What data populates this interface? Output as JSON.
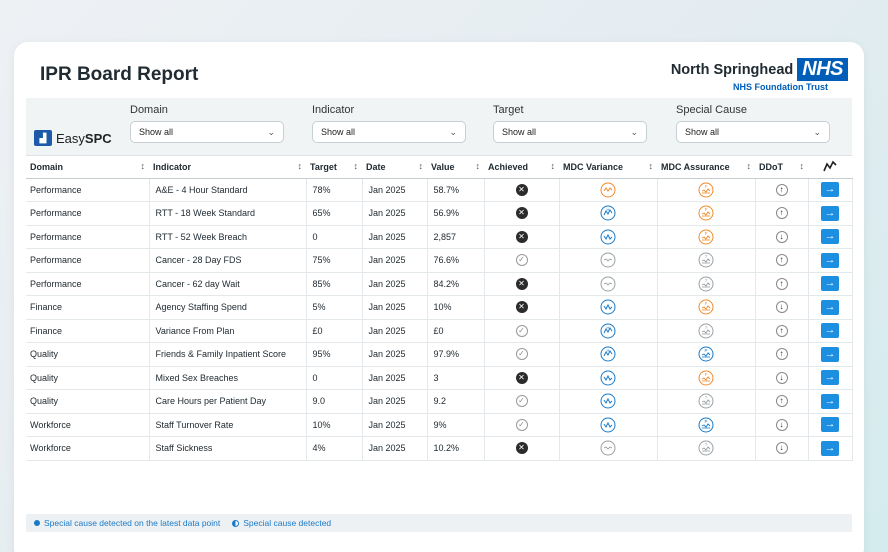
{
  "header": {
    "title": "IPR Board Report"
  },
  "trust": {
    "name": "North Springhead",
    "logo_text": "NHS",
    "subtitle": "NHS Foundation Trust"
  },
  "brand": {
    "light": "Easy",
    "bold": "SPC"
  },
  "filters": [
    {
      "label": "Domain",
      "value": "Show all"
    },
    {
      "label": "Indicator",
      "value": "Show all"
    },
    {
      "label": "Target",
      "value": "Show all"
    },
    {
      "label": "Special Cause",
      "value": "Show all"
    }
  ],
  "columns": [
    "Domain",
    "Indicator",
    "Target",
    "Date",
    "Value",
    "Achieved",
    "MDC Variance",
    "MDC Assurance",
    "DDoT"
  ],
  "colors": {
    "variance_blue": "#1a7ac7",
    "variance_orange": "#f08a2a",
    "neutral_grey": "#9aa0a4",
    "action_blue": "#1c8fe0"
  },
  "rows": [
    {
      "domain": "Performance",
      "indicator": "A&E - 4 Hour Standard",
      "target": "78%",
      "date": "Jan 2025",
      "value": "58.7%",
      "achieved": false,
      "variance": "concern-orange",
      "assurance": "fail-orange",
      "ddot": "up"
    },
    {
      "domain": "Performance",
      "indicator": "RTT - 18 Week Standard",
      "target": "65%",
      "date": "Jan 2025",
      "value": "56.9%",
      "achieved": false,
      "variance": "improvement-high-blue",
      "assurance": "fail-orange",
      "ddot": "up"
    },
    {
      "domain": "Performance",
      "indicator": "RTT - 52 Week Breach",
      "target": "0",
      "date": "Jan 2025",
      "value": "2,857",
      "achieved": false,
      "variance": "improvement-low-blue",
      "assurance": "fail-orange",
      "ddot": "down"
    },
    {
      "domain": "Performance",
      "indicator": "Cancer - 28 Day FDS",
      "target": "75%",
      "date": "Jan 2025",
      "value": "76.6%",
      "achieved": true,
      "variance": "common-grey",
      "assurance": "variable-grey",
      "ddot": "up"
    },
    {
      "domain": "Performance",
      "indicator": "Cancer - 62 day Wait",
      "target": "85%",
      "date": "Jan 2025",
      "value": "84.2%",
      "achieved": false,
      "variance": "common-grey",
      "assurance": "variable-grey",
      "ddot": "up"
    },
    {
      "domain": "Finance",
      "indicator": "Agency Staffing Spend",
      "target": "5%",
      "date": "Jan 2025",
      "value": "10%",
      "achieved": false,
      "variance": "improvement-low-blue",
      "assurance": "fail-orange",
      "ddot": "down"
    },
    {
      "domain": "Finance",
      "indicator": "Variance From Plan",
      "target": "£0",
      "date": "Jan 2025",
      "value": "£0",
      "achieved": true,
      "variance": "improvement-high-blue",
      "assurance": "variable-grey",
      "ddot": "up"
    },
    {
      "domain": "Quality",
      "indicator": "Friends & Family Inpatient Score",
      "target": "95%",
      "date": "Jan 2025",
      "value": "97.9%",
      "achieved": true,
      "variance": "improvement-high-blue",
      "assurance": "pass-blue",
      "ddot": "up"
    },
    {
      "domain": "Quality",
      "indicator": "Mixed Sex Breaches",
      "target": "0",
      "date": "Jan 2025",
      "value": "3",
      "achieved": false,
      "variance": "improvement-low-blue",
      "assurance": "fail-orange",
      "ddot": "down"
    },
    {
      "domain": "Quality",
      "indicator": "Care Hours per Patient Day",
      "target": "9.0",
      "date": "Jan 2025",
      "value": "9.2",
      "achieved": true,
      "variance": "improvement-low-blue",
      "assurance": "variable-grey",
      "ddot": "up"
    },
    {
      "domain": "Workforce",
      "indicator": "Staff Turnover Rate",
      "target": "10%",
      "date": "Jan 2025",
      "value": "9%",
      "achieved": true,
      "variance": "improvement-low-blue",
      "assurance": "pass-blue",
      "ddot": "down"
    },
    {
      "domain": "Workforce",
      "indicator": "Staff Sickness",
      "target": "4%",
      "date": "Jan 2025",
      "value": "10.2%",
      "achieved": false,
      "variance": "common-grey",
      "assurance": "variable-grey",
      "ddot": "down"
    }
  ],
  "legend": {
    "latest": "Special cause detected on the latest data point",
    "detected": "Special cause detected"
  }
}
